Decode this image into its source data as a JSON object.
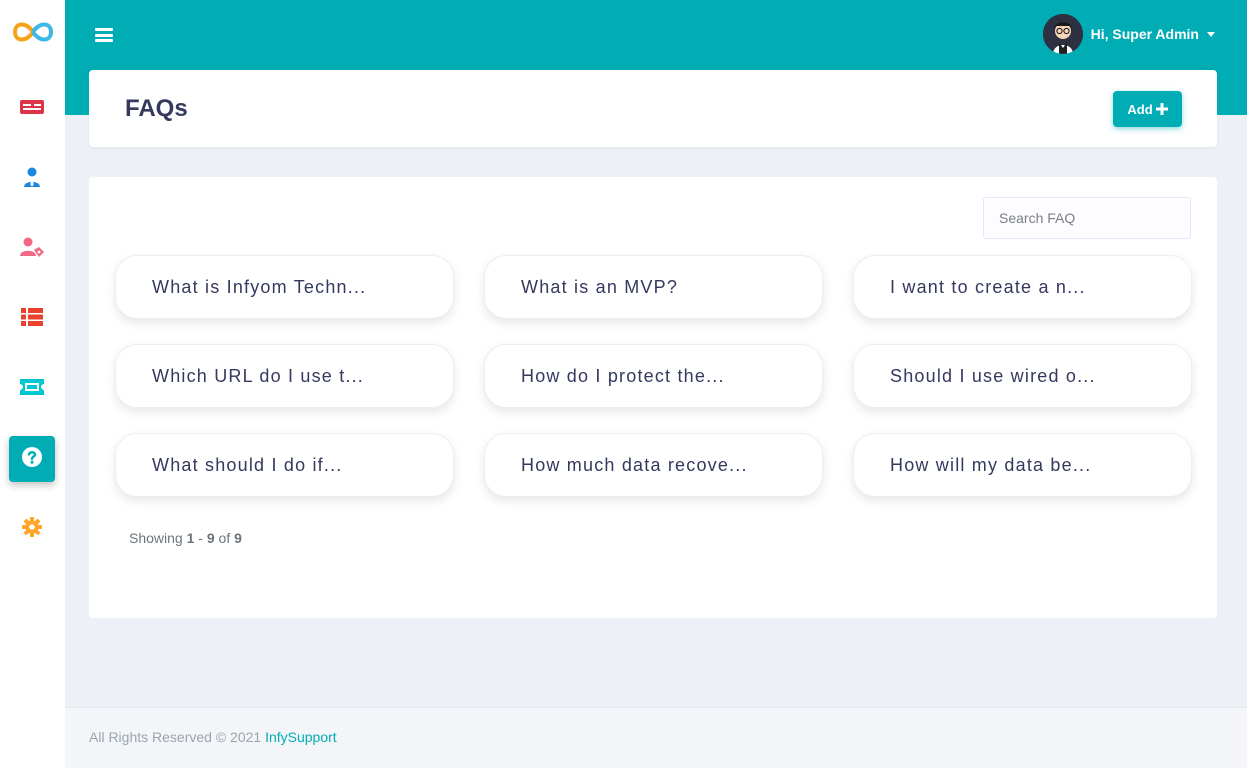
{
  "sidebar": {
    "logo": "infinity-logo",
    "items": [
      {
        "icon": "id-card-icon",
        "color": "#dc3545"
      },
      {
        "icon": "user-tie-icon",
        "color": "#1e88e5"
      },
      {
        "icon": "user-tag-icon",
        "color": "#f06a86"
      },
      {
        "icon": "list-icon",
        "color": "#e8412c"
      },
      {
        "icon": "ticket-icon",
        "color": "#00c8d0"
      },
      {
        "icon": "question-circle-icon",
        "color": "#ffffff",
        "active": true
      },
      {
        "icon": "gear-icon",
        "color": "#ffa426"
      }
    ]
  },
  "topbar": {
    "greeting": "Hi, Super Admin",
    "accent": "#00adb5"
  },
  "header": {
    "title": "FAQs",
    "add_label": "Add"
  },
  "search": {
    "placeholder": "Search FAQ"
  },
  "faqs": [
    "What is Infyom Techn...",
    "What is an MVP?",
    "I want to create a n...",
    "Which URL do I use t...",
    "How do I protect the...",
    "Should I use wired o...",
    "What should I do if...",
    "How much data recove...",
    "How will my data be..."
  ],
  "pagination": {
    "prefix": "Showing",
    "from": "1",
    "dash": "-",
    "to": "9",
    "of": "of",
    "total": "9"
  },
  "footer": {
    "text": "All Rights Reserved © 2021",
    "link": "InfySupport"
  }
}
